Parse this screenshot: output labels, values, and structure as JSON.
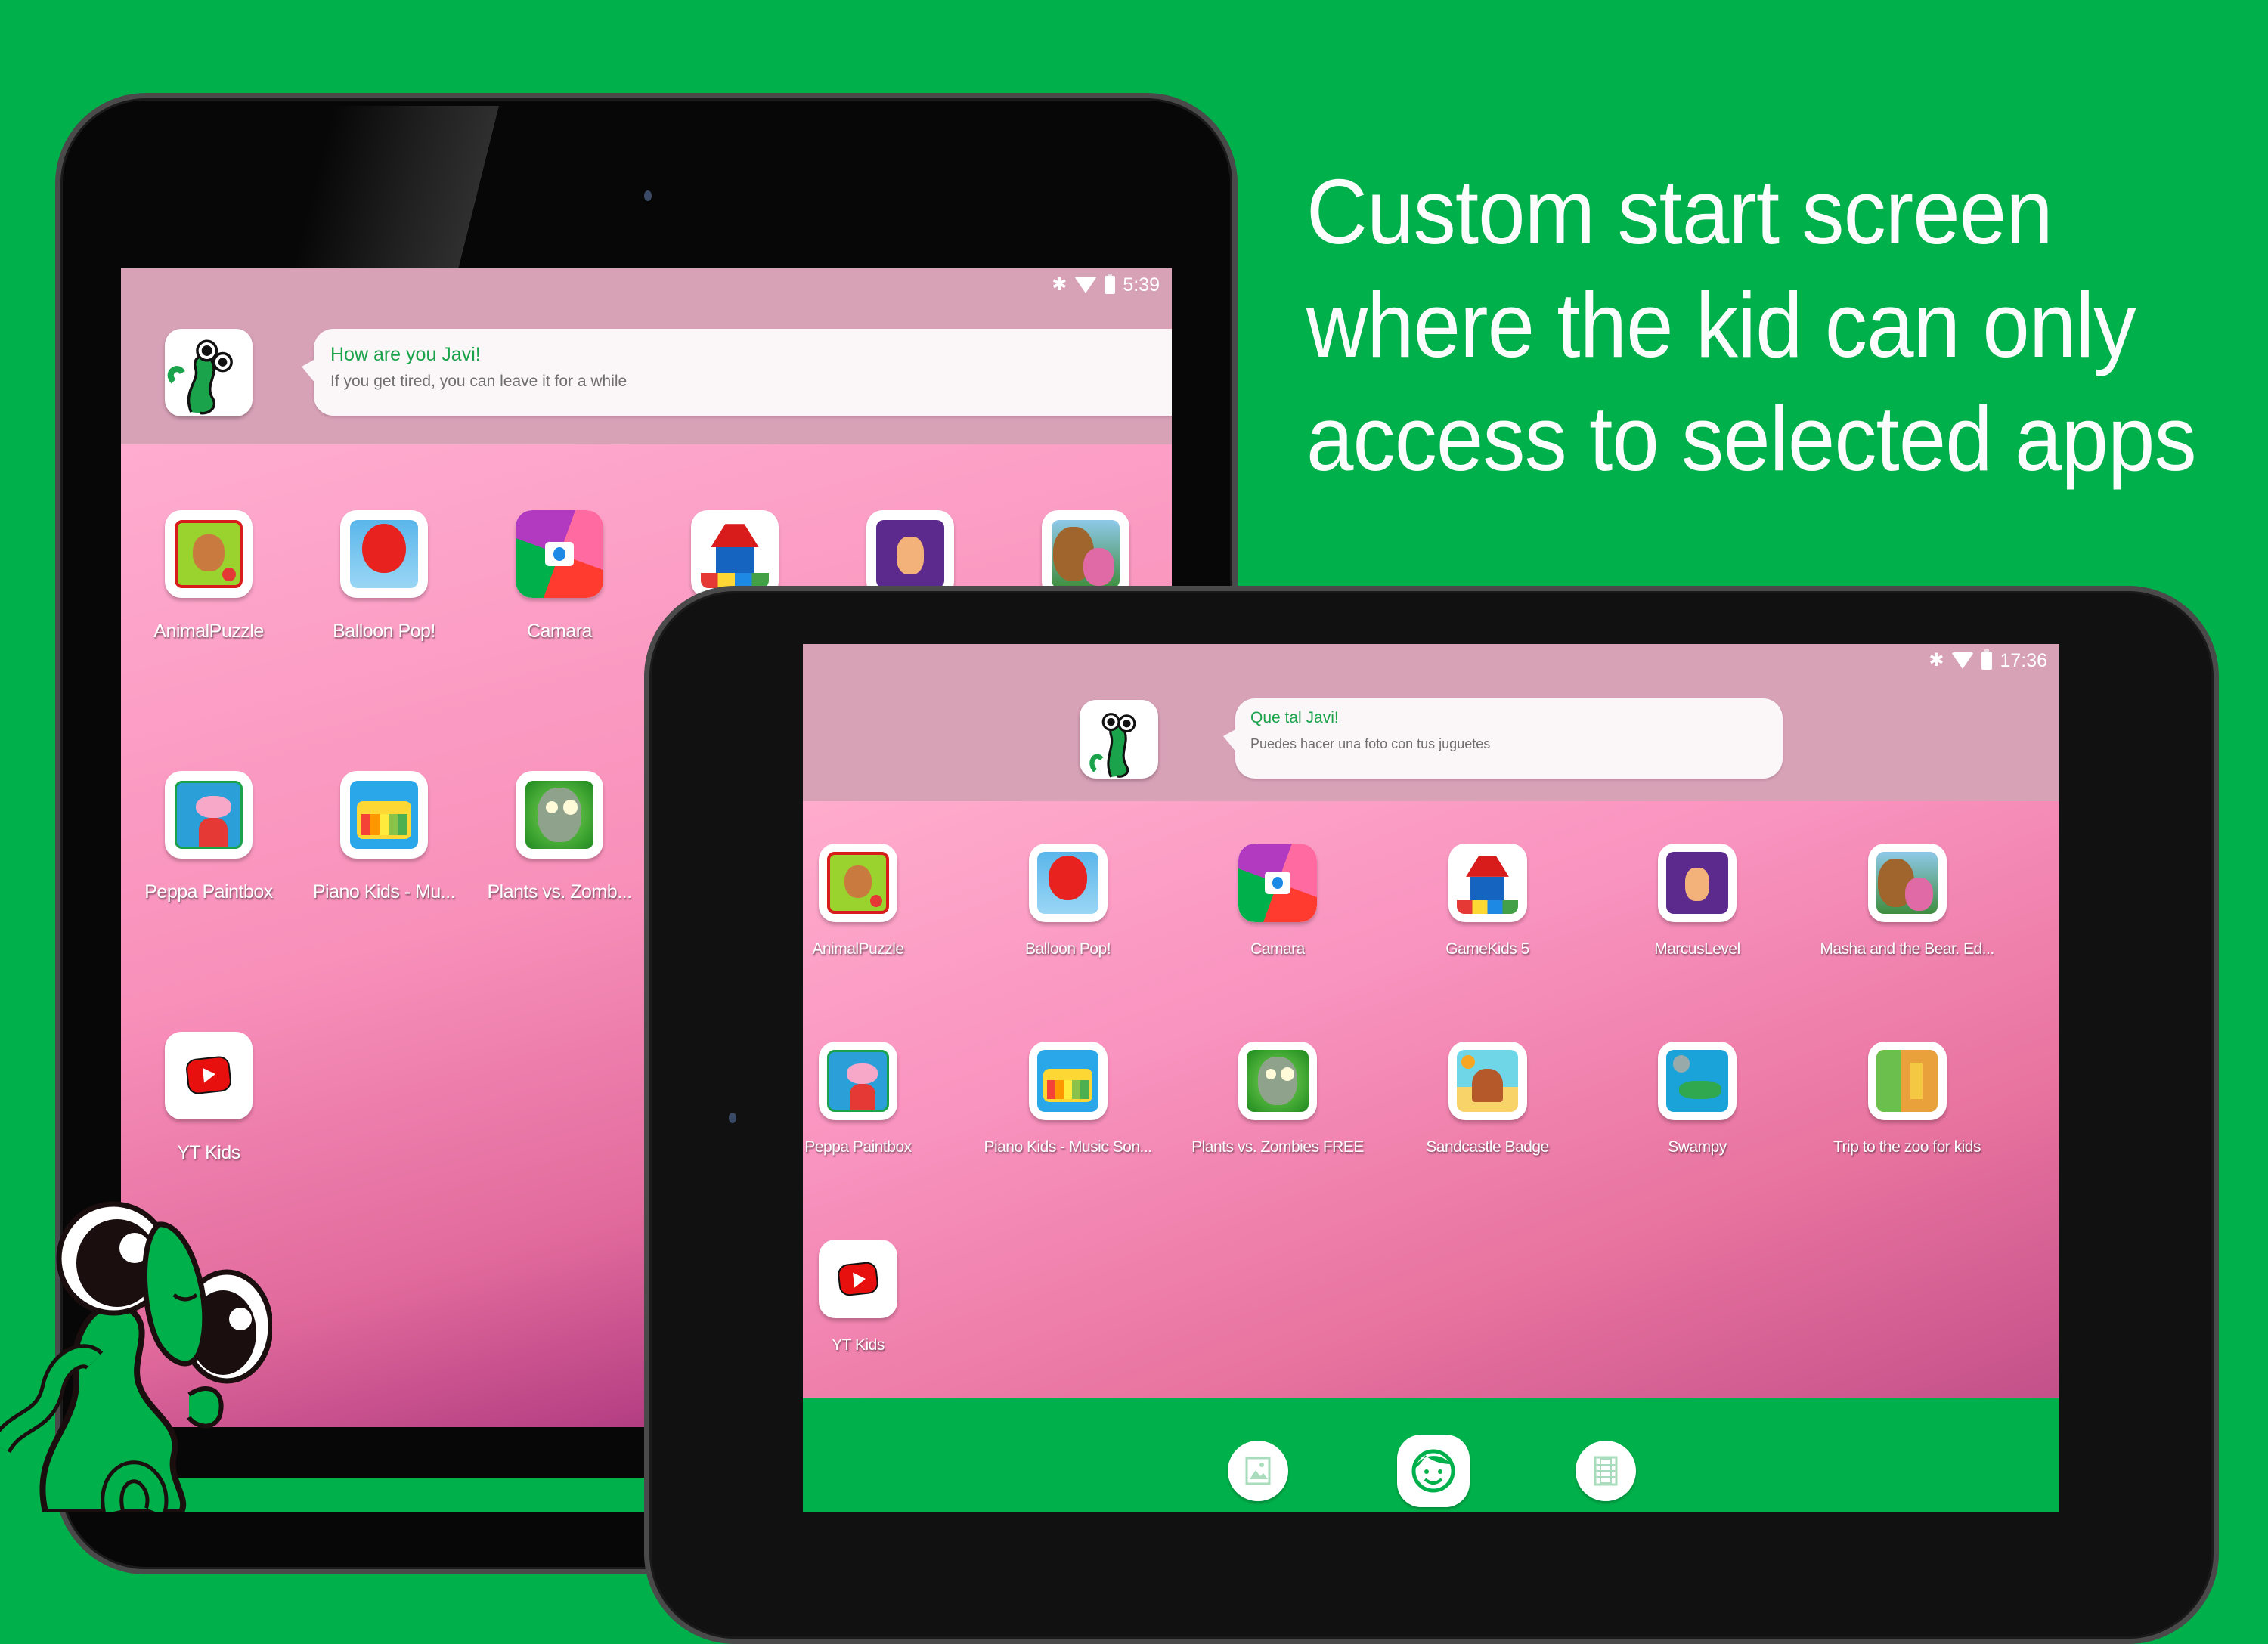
{
  "headline": {
    "lines": [
      "Custom start screen",
      "where the kid can only",
      "access to selected apps"
    ]
  },
  "colors": {
    "background": "#00b04a",
    "header_band": "#d7a1b6",
    "bubble_title": "#1aa34a",
    "bubble_text": "#6f6f6f",
    "bottom_bar": "#00b04a"
  },
  "left_tablet": {
    "status": {
      "icons": [
        "bluetooth-icon",
        "wifi-icon",
        "battery-icon"
      ],
      "time": "5:39"
    },
    "greeting": {
      "title": "How are you Javi!",
      "message": "If you get tired, you can leave it for a while"
    },
    "apps": [
      {
        "label": "AnimalPuzzle",
        "icon": "monkey-puzzle-icon"
      },
      {
        "label": "Balloon Pop!",
        "icon": "red-balloon-icon"
      },
      {
        "label": "Camara",
        "icon": "camera-icon"
      },
      {
        "label": "",
        "icon": "gamekids-house-icon"
      },
      {
        "label": "",
        "icon": "marcus-level-icon"
      },
      {
        "label": "",
        "icon": "masha-bear-icon"
      },
      {
        "label": "Peppa Paintbox",
        "icon": "peppa-pig-icon"
      },
      {
        "label": "Piano Kids - Mu...",
        "icon": "piano-icon"
      },
      {
        "label": "Plants vs. Zomb...",
        "icon": "zombie-icon"
      },
      {
        "label": "YT Kids",
        "icon": "youtube-kids-icon"
      }
    ]
  },
  "right_tablet": {
    "status": {
      "icons": [
        "bluetooth-icon",
        "wifi-icon",
        "battery-icon"
      ],
      "time": "17:36"
    },
    "greeting": {
      "title": "Que tal Javi!",
      "message": "Puedes hacer una foto con tus juguetes"
    },
    "apps": [
      {
        "label": "AnimalPuzzle",
        "icon": "monkey-puzzle-icon"
      },
      {
        "label": "Balloon Pop!",
        "icon": "red-balloon-icon"
      },
      {
        "label": "Camara",
        "icon": "camera-icon"
      },
      {
        "label": "GameKids 5",
        "icon": "gamekids-house-icon"
      },
      {
        "label": "MarcusLevel",
        "icon": "marcus-level-icon"
      },
      {
        "label": "Masha and the Bear. Ed...",
        "icon": "masha-bear-icon"
      },
      {
        "label": "Peppa Paintbox",
        "icon": "peppa-pig-icon"
      },
      {
        "label": "Piano Kids - Music Son...",
        "icon": "piano-icon"
      },
      {
        "label": "Plants vs. Zombies FREE",
        "icon": "zombie-icon"
      },
      {
        "label": "Sandcastle Badge",
        "icon": "sandcastle-icon"
      },
      {
        "label": "Swampy",
        "icon": "swampy-icon"
      },
      {
        "label": "Trip to the zoo for kids",
        "icon": "zoo-icon"
      },
      {
        "label": "YT Kids",
        "icon": "youtube-kids-icon"
      }
    ],
    "bottom_nav": [
      {
        "name": "gallery",
        "icon": "image-icon",
        "active": false
      },
      {
        "name": "kid-home",
        "icon": "kid-face-icon",
        "active": true
      },
      {
        "name": "videos",
        "icon": "film-icon",
        "active": false
      }
    ]
  }
}
